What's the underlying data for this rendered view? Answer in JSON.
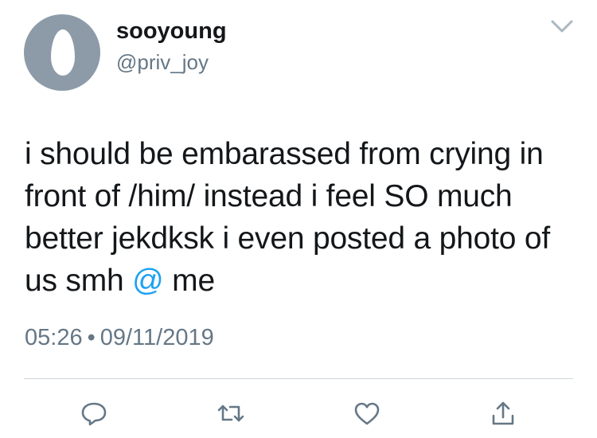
{
  "user": {
    "display_name": "sooyoung",
    "handle": "@priv_joy"
  },
  "tweet": {
    "text_before_mention": "i should be embarassed from crying in front of /him/ instead i feel SO much better jekdksk i even posted a photo of us smh ",
    "mention": "@",
    "text_after_mention": " me",
    "time": "05:26",
    "separator": "•",
    "date": "09/11/2019"
  },
  "actions": [
    {
      "name": "reply",
      "icon": "reply-icon"
    },
    {
      "name": "retweet",
      "icon": "retweet-icon"
    },
    {
      "name": "like",
      "icon": "heart-icon"
    },
    {
      "name": "share",
      "icon": "share-icon"
    }
  ],
  "colors": {
    "text": "#14171a",
    "secondary": "#657786",
    "accent": "#1da1f2",
    "avatar_bg": "#8d9ba8",
    "divider": "#cfd6dc"
  }
}
